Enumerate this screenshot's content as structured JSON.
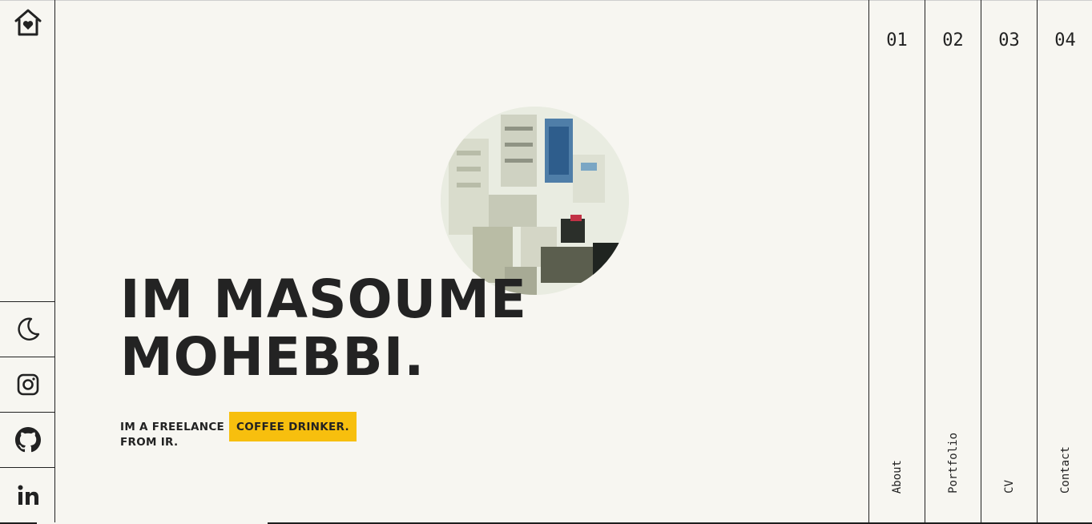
{
  "nav": {
    "items": [
      {
        "number": "01",
        "label": "About"
      },
      {
        "number": "02",
        "label": "Portfolio"
      },
      {
        "number": "03",
        "label": "CV"
      },
      {
        "number": "04",
        "label": "Contact"
      }
    ]
  },
  "sidebar": {
    "home_icon": "home-heart-icon",
    "social": [
      {
        "icon": "moon-icon"
      },
      {
        "icon": "instagram-icon"
      },
      {
        "icon": "github-icon"
      },
      {
        "icon": "linkedin-icon"
      }
    ]
  },
  "hero": {
    "name_line1": "IM MASOUME",
    "name_line2": "MOHEBBI.",
    "tagline_prefix": "IM A FREELANCE",
    "tagline_highlight": "COFFEE DRINKER.",
    "tagline_suffix": "FROM IR."
  },
  "colors": {
    "background": "#f7f6f1",
    "text": "#222222",
    "accent": "#f7bf0e"
  }
}
